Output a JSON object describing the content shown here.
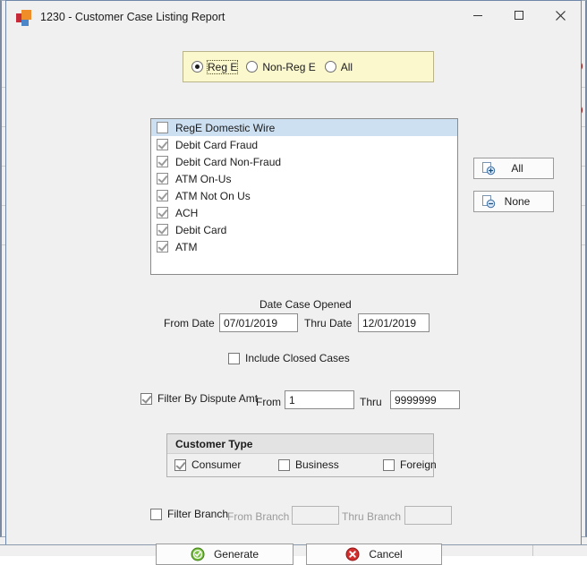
{
  "window": {
    "title": "1230 - Customer Case Listing Report",
    "icon": "app-squares-icon",
    "controls": {
      "minimize": "minimize-icon",
      "maximize": "maximize-icon",
      "close": "close-icon"
    }
  },
  "type_filter": {
    "options": [
      {
        "label": "Reg E",
        "selected": true,
        "focused": true
      },
      {
        "label": "Non-Reg E",
        "selected": false,
        "focused": false
      },
      {
        "label": "All",
        "selected": false,
        "focused": false
      }
    ]
  },
  "category_list": {
    "items": [
      {
        "label": "RegE Domestic Wire",
        "checked": false,
        "selected": true
      },
      {
        "label": "Debit Card Fraud",
        "checked": true,
        "selected": false
      },
      {
        "label": "Debit Card Non-Fraud",
        "checked": true,
        "selected": false
      },
      {
        "label": "ATM On-Us",
        "checked": true,
        "selected": false
      },
      {
        "label": "ATM Not On Us",
        "checked": true,
        "selected": false
      },
      {
        "label": "ACH",
        "checked": true,
        "selected": false
      },
      {
        "label": "Debit Card",
        "checked": true,
        "selected": false
      },
      {
        "label": "ATM",
        "checked": true,
        "selected": false
      }
    ]
  },
  "selection_buttons": {
    "all": {
      "label": "All",
      "icon": "page-add-icon"
    },
    "none": {
      "label": "None",
      "icon": "page-remove-icon"
    }
  },
  "date_section": {
    "title": "Date Case Opened",
    "from_label": "From Date",
    "from_value": "07/01/2019",
    "thru_label": "Thru Date",
    "thru_value": "12/01/2019"
  },
  "include_closed_cases": {
    "label": "Include Closed Cases",
    "checked": false
  },
  "dispute_amount": {
    "filter_label": "Filter By Dispute Amt",
    "filter_checked": true,
    "from_label": "From",
    "from_value": "1",
    "thru_label": "Thru",
    "thru_value": "9999999"
  },
  "customer_type": {
    "title": "Customer Type",
    "options": [
      {
        "label": "Consumer",
        "checked": true
      },
      {
        "label": "Business",
        "checked": false
      },
      {
        "label": "Foreign",
        "checked": false
      }
    ]
  },
  "branch_filter": {
    "filter_label": "Filter Branch",
    "filter_checked": false,
    "from_label": "From Branch",
    "from_value": "",
    "thru_label": "Thru Branch",
    "thru_value": "",
    "disabled": true
  },
  "actions": {
    "generate": {
      "label": "Generate",
      "icon": "green-check-circle-icon"
    },
    "cancel": {
      "label": "Cancel",
      "icon": "red-x-circle-icon"
    }
  },
  "colors": {
    "dialog_bg": "#f0f0f0",
    "radio_group_bg": "#fbf8ce",
    "list_selected_bg": "#cde0f2",
    "generate_icon": "#5aa02c",
    "cancel_icon": "#c62828",
    "title_border": "#6f87a8"
  }
}
